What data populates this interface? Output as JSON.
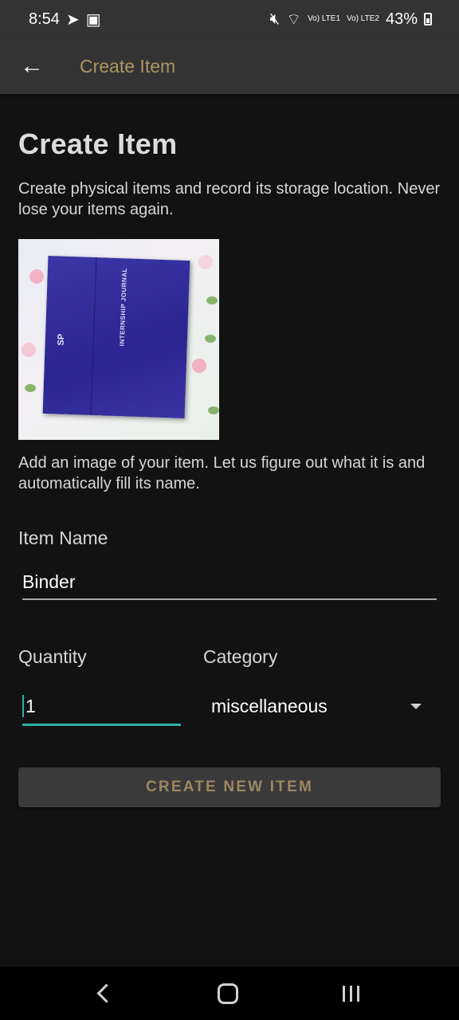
{
  "status_bar": {
    "time": "8:54",
    "battery": "43%",
    "icons": [
      "telegram-icon",
      "gallery-icon",
      "mute-icon",
      "wifi-icon",
      "signal-lte1-icon",
      "signal-lte2-icon",
      "battery-icon"
    ],
    "lte1": "Vo) LTE1",
    "lte2": "Vo) LTE2"
  },
  "app_bar": {
    "title": "Create Item",
    "accent": "#b09464"
  },
  "main": {
    "title": "Create Item",
    "description": "Create physical items and record its storage location. Never lose your items again.",
    "photo_hint": "Add an image of your item. Let us figure out what it is and automatically fill its name.",
    "photo_text": {
      "logo": "SP",
      "binder_label": "INTERNSHIP JOURNAL"
    },
    "item_name_label": "Item Name",
    "item_name_value": "Binder",
    "quantity_label": "Quantity",
    "quantity_value": "1",
    "category_label": "Category",
    "category_value": "miscellaneous",
    "create_button": "CREATE NEW ITEM"
  },
  "colors": {
    "focus": "#2ab2a6",
    "button_text": "#9c8762"
  }
}
